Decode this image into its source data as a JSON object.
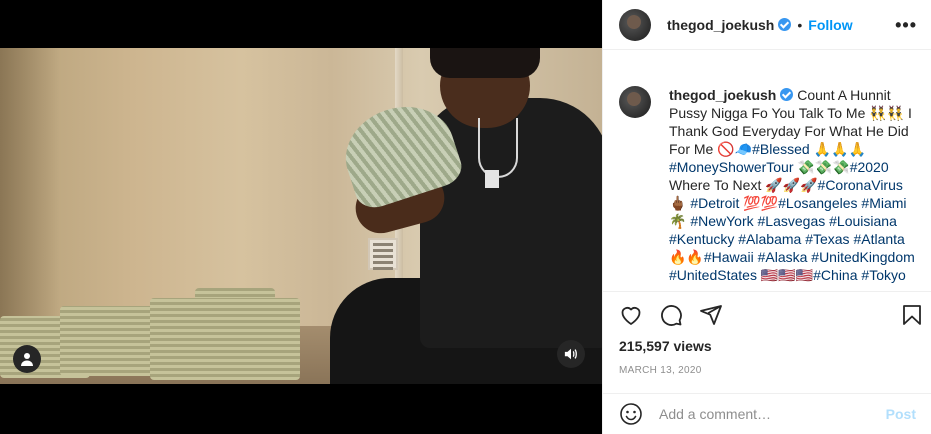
{
  "video": {
    "account_icon": "user-icon",
    "sound_icon": "speaker-icon"
  },
  "header": {
    "username": "thegod_joekush",
    "separator": "•",
    "follow_label": "Follow",
    "more_icon": "more-horizontal-icon",
    "more_label": "•••"
  },
  "caption": {
    "username": "thegod_joekush",
    "segments": [
      {
        "t": " Count A Hunnit Pussy Nigga Fo You Talk To Me 👯‍♂️👯‍♂️ I Thank God Everyday For What He Did For Me 🚫🧢",
        "tag": false
      },
      {
        "t": "#Blessed",
        "tag": true
      },
      {
        "t": " 🙏🙏🙏 ",
        "tag": false
      },
      {
        "t": "#MoneyShowerTour",
        "tag": true
      },
      {
        "t": " 💸💸💸",
        "tag": false
      },
      {
        "t": "#2020",
        "tag": true
      },
      {
        "t": " Where To Next 🚀🚀🚀",
        "tag": false
      },
      {
        "t": "#CoronaVirus",
        "tag": true
      },
      {
        "t": " 🖕🏾 ",
        "tag": false
      },
      {
        "t": "#Detroit",
        "tag": true
      },
      {
        "t": " 💯💯",
        "tag": false
      },
      {
        "t": "#Losangeles",
        "tag": true
      },
      {
        "t": " ",
        "tag": false
      },
      {
        "t": "#Miami",
        "tag": true
      },
      {
        "t": " 🌴 ",
        "tag": false
      },
      {
        "t": "#NewYork",
        "tag": true
      },
      {
        "t": " ",
        "tag": false
      },
      {
        "t": "#Lasvegas",
        "tag": true
      },
      {
        "t": " ",
        "tag": false
      },
      {
        "t": "#Louisiana",
        "tag": true
      },
      {
        "t": " ",
        "tag": false
      },
      {
        "t": "#Kentucky",
        "tag": true
      },
      {
        "t": " ",
        "tag": false
      },
      {
        "t": "#Alabama",
        "tag": true
      },
      {
        "t": " ",
        "tag": false
      },
      {
        "t": "#Texas",
        "tag": true
      },
      {
        "t": " ",
        "tag": false
      },
      {
        "t": "#Atlanta",
        "tag": true
      },
      {
        "t": " 🔥🔥",
        "tag": false
      },
      {
        "t": "#Hawaii",
        "tag": true
      },
      {
        "t": " ",
        "tag": false
      },
      {
        "t": "#Alaska",
        "tag": true
      },
      {
        "t": " ",
        "tag": false
      },
      {
        "t": "#UnitedKingdom",
        "tag": true
      },
      {
        "t": " ",
        "tag": false
      },
      {
        "t": "#UnitedStates",
        "tag": true
      },
      {
        "t": " 🇺🇸🇺🇸🇺🇸",
        "tag": false
      },
      {
        "t": "#China",
        "tag": true
      },
      {
        "t": " ",
        "tag": false
      },
      {
        "t": "#Tokyo",
        "tag": true
      }
    ]
  },
  "actions": {
    "like_icon": "heart-icon",
    "comment_icon": "comment-icon",
    "share_icon": "share-icon",
    "save_icon": "bookmark-icon"
  },
  "stats": {
    "views": "215,597 views",
    "date": "MARCH 13, 2020"
  },
  "comment": {
    "emoji_icon": "smiley-icon",
    "placeholder": "Add a comment…",
    "post_label": "Post"
  },
  "colors": {
    "link": "#00376b",
    "follow": "#0095f6",
    "post_disabled": "#b2dffc",
    "verified": "#3897f0"
  }
}
